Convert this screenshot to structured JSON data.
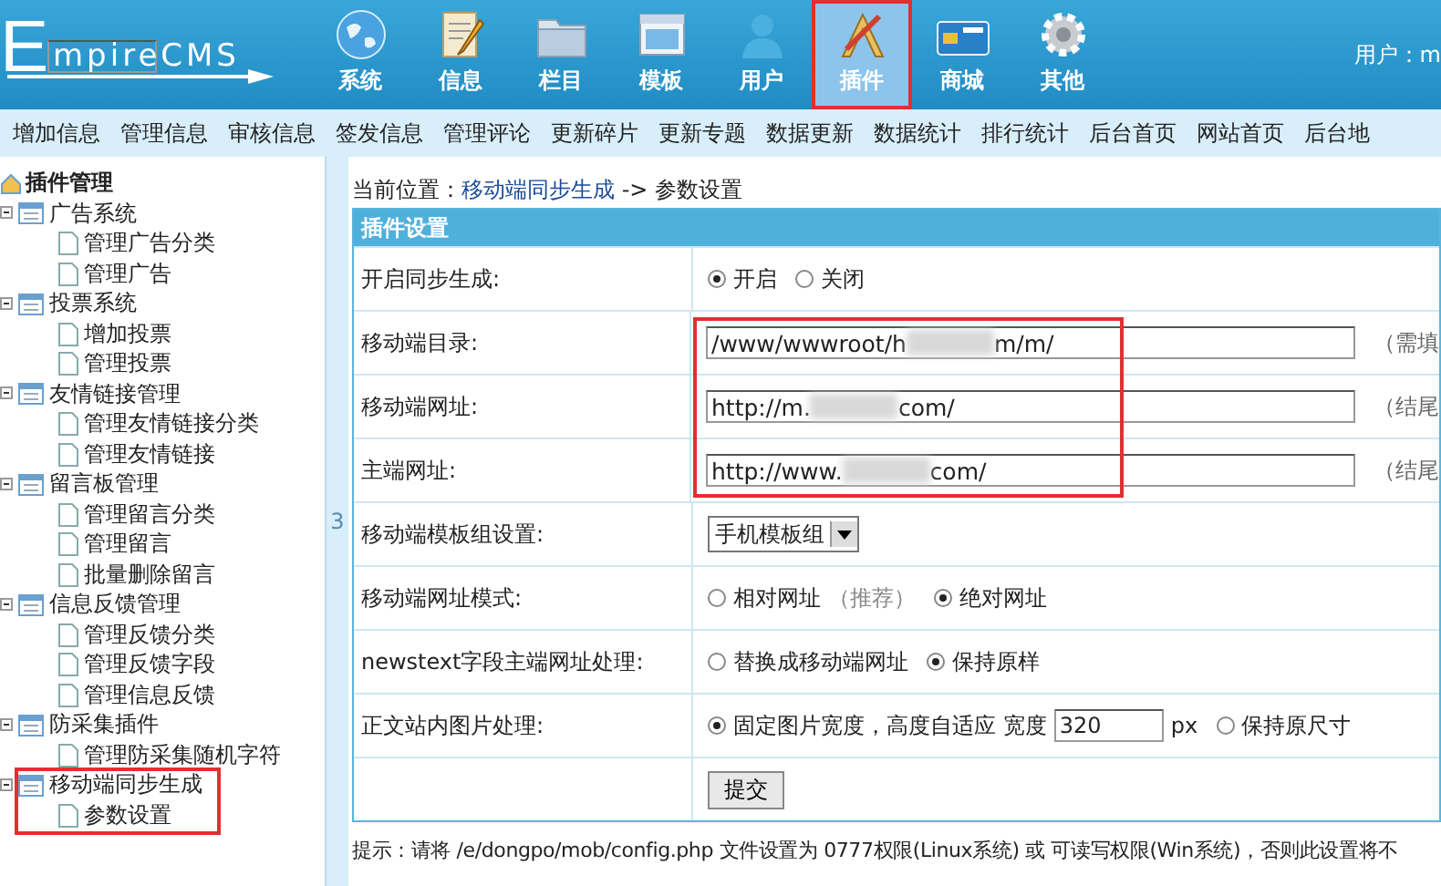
{
  "logo": {
    "text": "mpireCMS",
    "initial": "E"
  },
  "nav": [
    {
      "label": "系统",
      "kind": "globe",
      "selected": false
    },
    {
      "label": "信息",
      "kind": "document",
      "selected": false
    },
    {
      "label": "栏目",
      "kind": "folder",
      "selected": false
    },
    {
      "label": "模板",
      "kind": "window",
      "selected": false
    },
    {
      "label": "用户",
      "kind": "person",
      "selected": false
    },
    {
      "label": "插件",
      "kind": "tools",
      "selected": true
    },
    {
      "label": "商城",
      "kind": "card",
      "selected": false
    },
    {
      "label": "其他",
      "kind": "gear",
      "selected": false
    }
  ],
  "user": "用户：m",
  "menu": [
    "增加信息",
    "管理信息",
    "审核信息",
    "签发信息",
    "管理评论",
    "更新碎片",
    "更新专题",
    "数据更新",
    "数据统计",
    "排行统计",
    "后台首页",
    "网站首页",
    "后台地"
  ],
  "sidebar": {
    "title": "插件管理",
    "groups": [
      {
        "label": "广告系统",
        "highlighted": false,
        "children": [
          "管理广告分类",
          "管理广告"
        ]
      },
      {
        "label": "投票系统",
        "highlighted": false,
        "children": [
          "增加投票",
          "管理投票"
        ]
      },
      {
        "label": "友情链接管理",
        "highlighted": false,
        "children": [
          "管理友情链接分类",
          "管理友情链接"
        ]
      },
      {
        "label": "留言板管理",
        "highlighted": false,
        "children": [
          "管理留言分类",
          "管理留言",
          "批量删除留言"
        ]
      },
      {
        "label": "信息反馈管理",
        "highlighted": false,
        "children": [
          "管理反馈分类",
          "管理反馈字段",
          "管理信息反馈"
        ]
      },
      {
        "label": "防采集插件",
        "highlighted": false,
        "children": [
          "管理防采集随机字符"
        ]
      },
      {
        "label": "移动端同步生成",
        "highlighted": true,
        "children": [
          "参数设置"
        ]
      }
    ]
  },
  "splitter": "3",
  "breadcrumb": {
    "prefix": "当前位置：",
    "link": "移动端同步生成",
    "rest": "-> 参数设置"
  },
  "panel": {
    "title": "插件设置",
    "rows": [
      {
        "kind": "radio",
        "label": "开启同步生成:",
        "highlighted": false,
        "options": [
          {
            "label": "开启",
            "selected": true
          },
          {
            "label": "关闭",
            "selected": false
          }
        ]
      },
      {
        "kind": "text",
        "label": "移动端目录:",
        "highlighted": true,
        "value": [
          "/www/wwwroot/h",
          "m/m/"
        ],
        "hint": "（需填"
      },
      {
        "kind": "text",
        "label": "移动端网址:",
        "highlighted": true,
        "value": [
          "http://m.",
          "com/"
        ],
        "hint": "（结尾"
      },
      {
        "kind": "text",
        "label": "主端网址:",
        "highlighted": true,
        "value": [
          "http://www.",
          "com/"
        ],
        "hint": "（结尾"
      },
      {
        "kind": "select",
        "label": "移动端模板组设置:",
        "highlighted": false,
        "value": "手机模板组"
      },
      {
        "kind": "radio",
        "label": "移动端网址模式:",
        "highlighted": false,
        "options": [
          {
            "label": "相对网址",
            "note": "（推荐）",
            "selected": false
          },
          {
            "label": "绝对网址",
            "selected": true
          }
        ]
      },
      {
        "kind": "radio",
        "label": "newstext字段主端网址处理:",
        "highlighted": false,
        "options": [
          {
            "label": "替换成移动端网址",
            "selected": false
          },
          {
            "label": "保持原样",
            "selected": true
          }
        ]
      },
      {
        "kind": "radio",
        "label": "正文站内图片处理:",
        "highlighted": false,
        "options": [
          {
            "label": "固定图片宽度，高度自适应 宽度",
            "input": "320",
            "unit": "px",
            "selected": true
          },
          {
            "label": "保持原尺寸",
            "selected": false
          }
        ]
      },
      {
        "kind": "button",
        "label": "",
        "highlighted": false,
        "button": "提交"
      }
    ]
  },
  "tip": "提示：请将 /e/dongpo/mob/config.php 文件设置为 0777权限(Linux系统) 或 可读写权限(Win系统)，否则此设置将不"
}
